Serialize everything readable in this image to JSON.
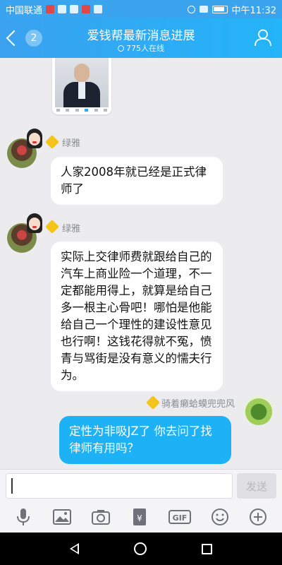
{
  "status_bar": {
    "carrier": "中国联通",
    "time": "中午11:32"
  },
  "header": {
    "back_badge": "2",
    "title": "爱钱帮最新消息进展",
    "online_count": "775人在线"
  },
  "messages": [
    {
      "sender": "绿雅",
      "text": "人家2008年就已经是正式律师了"
    },
    {
      "sender": "绿雅",
      "text": "实际上交律师费就跟给自己的汽车上商业险一个道理，不一定都能用得上，就算是给自己多一根主心骨吧！哪怕是他能给自己一个理性的建设性意见也行啊！这钱花得就不冤，愤青与骂街是没有意义的懦夫行为。"
    },
    {
      "sender": "骑着癞蛤蟆兜兜风",
      "text": "定性为非吸JZ了 你去问了找律师有用吗？"
    }
  ],
  "input": {
    "value": "",
    "send_label": "发送"
  },
  "toolbar": {
    "icons": [
      "microphone-icon",
      "image-icon",
      "camera-icon",
      "red-packet-icon",
      "gif-icon",
      "emoji-icon",
      "plus-icon"
    ],
    "gif_label": "GIF",
    "yen_label": "¥"
  }
}
